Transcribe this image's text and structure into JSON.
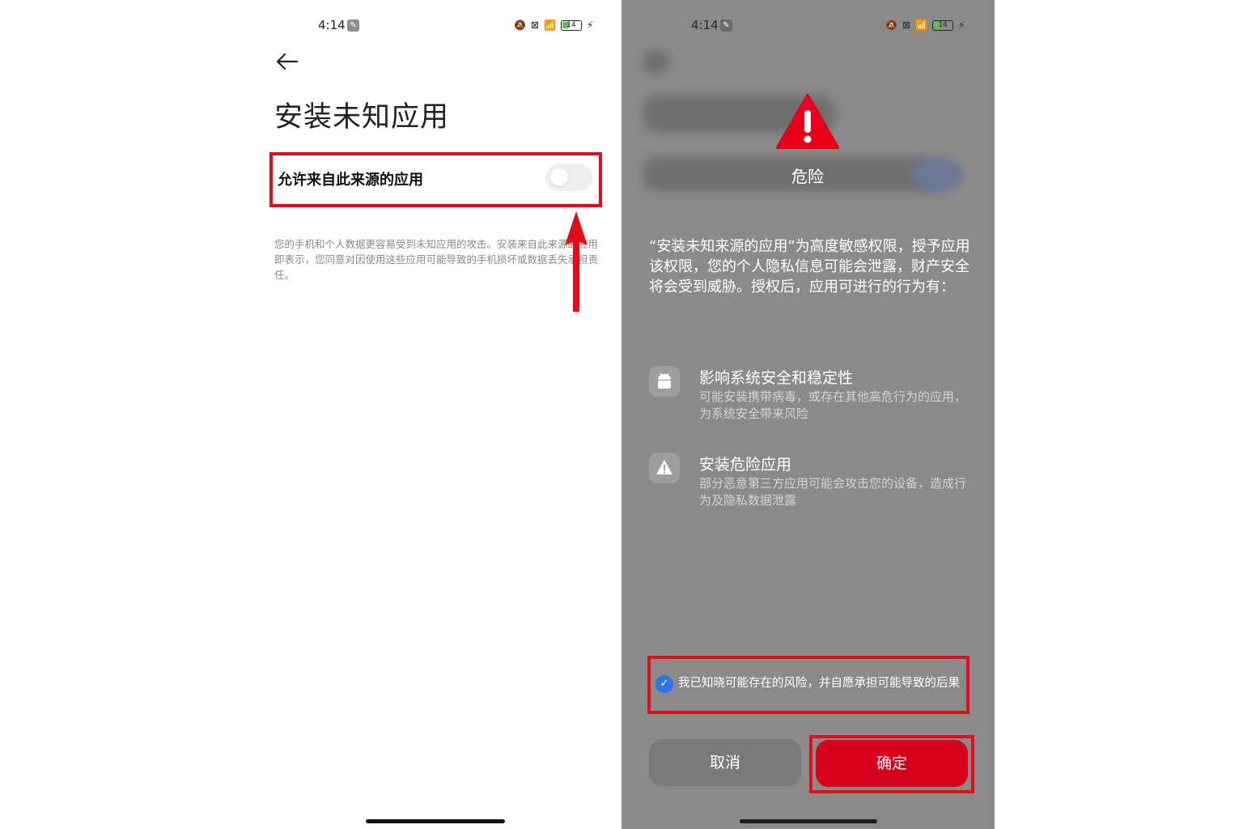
{
  "status_bar": {
    "time": "4:14",
    "battery": "14"
  },
  "left": {
    "title": "安装未知应用",
    "allow_label": "允许来自此来源的应用",
    "toggle_on": false,
    "description": "您的手机和个人数据更容易受到未知应用的攻击。安装来自此来源的应用即表示，您同意对因使用这些应用可能导致的手机损坏或数据丢失承担责任。"
  },
  "right": {
    "danger_label": "危险",
    "warning_text": "“安装未知来源的应用”为高度敏感权限，授予应用该权限，您的个人隐私信息可能会泄露，财产安全将会受到威胁。授权后，应用可进行的行为有：",
    "permissions": [
      {
        "icon": "android-icon",
        "title": "影响系统安全和稳定性",
        "desc": "可能安装携带病毒，或存在其他高危行为的应用，为系统安全带来风险"
      },
      {
        "icon": "warning-triangle-icon",
        "title": "安装危险应用",
        "desc": "部分恶意第三方应用可能会攻击您的设备，造成行为及隐私数据泄露"
      }
    ],
    "consent": "我已知晓可能存在的风险，并自愿承担可能导致的后果",
    "consent_checked": true,
    "cancel_label": "取消",
    "confirm_label": "确定"
  },
  "colors": {
    "highlight": "#e30d17",
    "confirm": "#d6001c",
    "check": "#2f74e8"
  }
}
